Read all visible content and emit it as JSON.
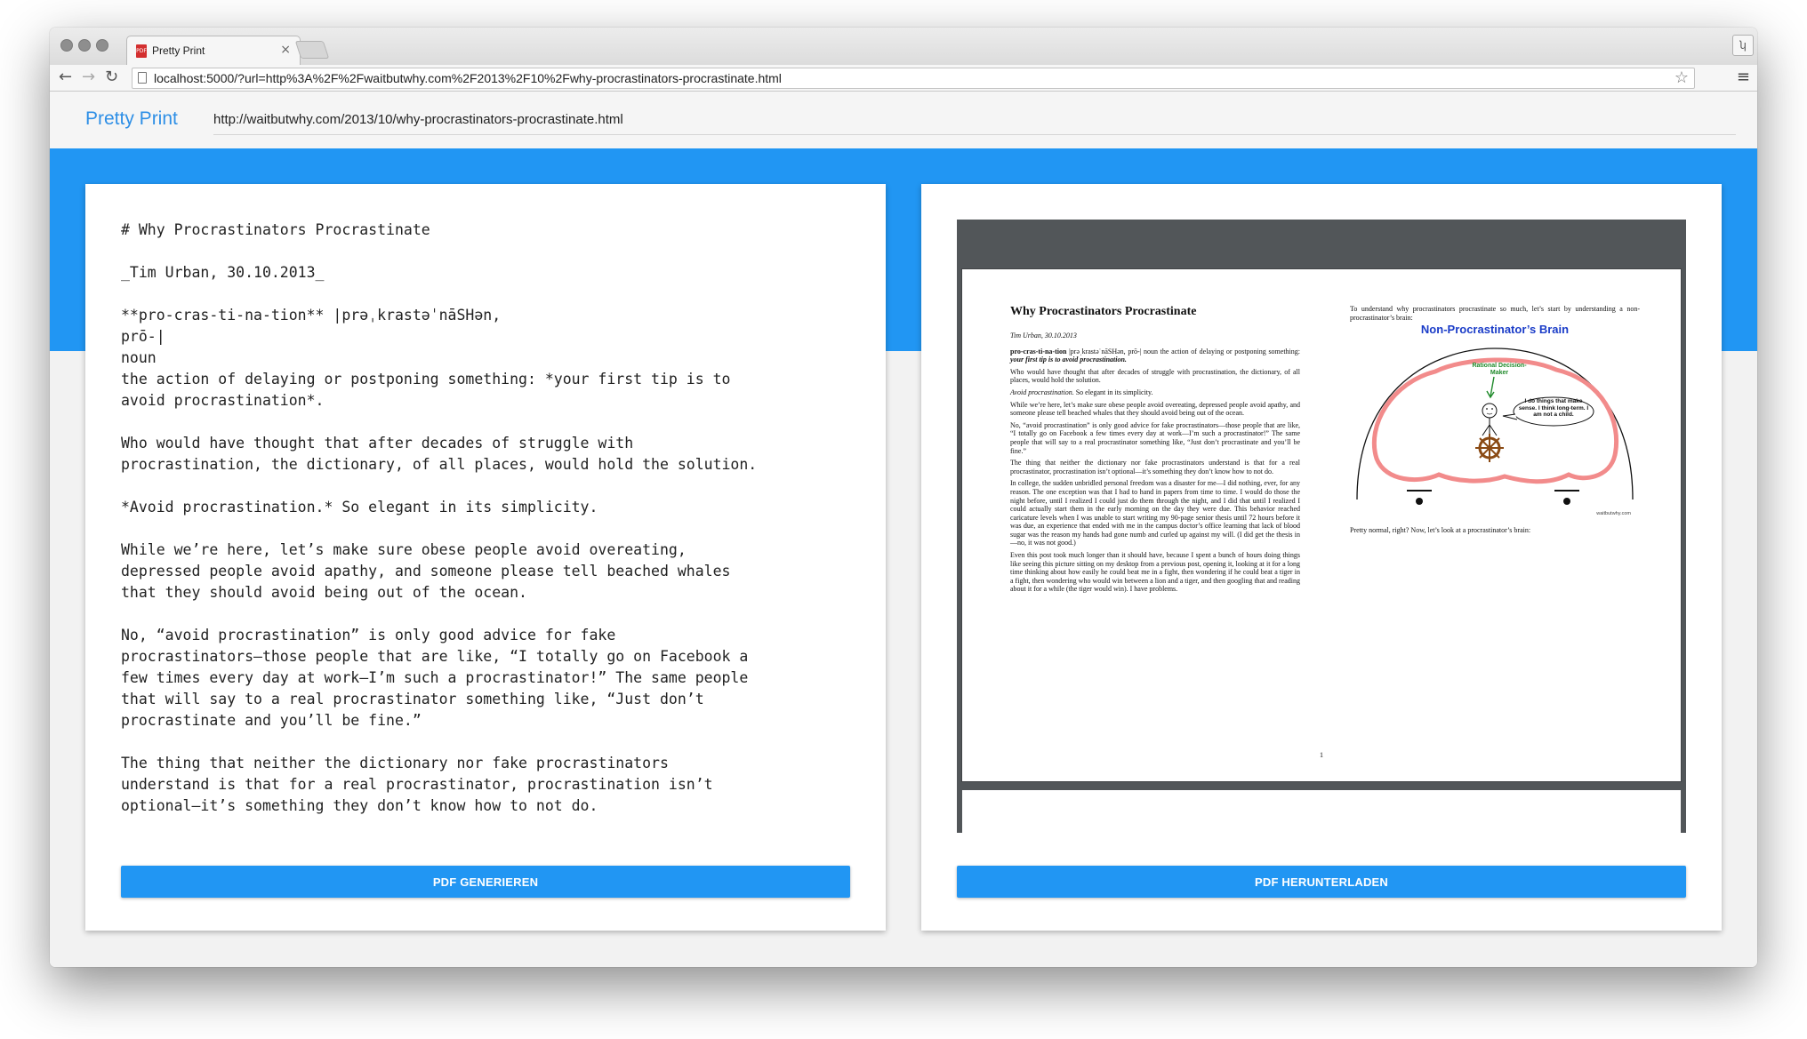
{
  "browser": {
    "tab_title": "Pretty Print",
    "tab_close": "×",
    "url": "localhost:5000/?url=http%3A%2F%2Fwaitbutwhy.com%2F2013%2F10%2Fwhy-procrastinators-procrastinate.html",
    "back_icon": "←",
    "forward_icon": "→",
    "reload_icon": "↻",
    "star_icon": "☆",
    "menu_icon": "≡"
  },
  "app": {
    "brand": "Pretty Print",
    "source_url": "http://waitbutwhy.com/2013/10/why-procrastinators-procrastinate.html",
    "accent_color": "#2196f3"
  },
  "editor": {
    "markdown": "# Why Procrastinators Procrastinate\n\n_Tim Urban, 30.10.2013_\n\n**pro-cras-ti-na-tion** |prəˌkrastəˈnāSHən,\nprō-|\nnoun\nthe action of delaying or postponing something: *your first tip is to\navoid procrastination*.\n\nWho would have thought that after decades of struggle with\nprocrastination, the dictionary, of all places, would hold the solution.\n\n*Avoid procrastination.* So elegant in its simplicity.\n\nWhile we’re here, let’s make sure obese people avoid overeating,\ndepressed people avoid apathy, and someone please tell beached whales\nthat they should avoid being out of the ocean.\n\nNo, “avoid procrastination” is only good advice for fake\nprocrastinators—those people that are like, “I totally go on Facebook a\nfew times every day at work—I’m such a procrastinator!” The same people\nthat will say to a real procrastinator something like, “Just don’t\nprocrastinate and you’ll be fine.”\n\nThe thing that neither the dictionary nor fake procrastinators\nunderstand is that for a real procrastinator, procrastination isn’t\noptional—it’s something they don’t know how to not do.",
    "generate_button": "PDF GENERIEREN"
  },
  "pdf": {
    "download_button": "PDF HERUNTERLADEN",
    "page_number": "1",
    "title": "Why Procrastinators Procrastinate",
    "byline": "Tim Urban, 30.10.2013",
    "def_term": "pro-cras-ti-na-tion",
    "def_rest": " |prəˌkrastəˈnāSHən, prō-| noun the action of delaying or postponing something: ",
    "def_italic": "your first tip is to avoid procrastination.",
    "p_who": "Who would have thought that after decades of struggle with procrastination, the dictionary, of all places, would hold the solution.",
    "avoid_italic": "Avoid procrastination.",
    "avoid_rest": " So elegant in its simplicity.",
    "p_while": "While we’re here, let’s make sure obese people avoid overeating, depressed people avoid apathy, and someone please tell beached whales that they should avoid being out of the ocean.",
    "p_no": "No, “avoid procrastination” is only good advice for fake procrastinators—those people that are like, “I totally go on Facebook a few times every day at work—I’m such a procrastinator!” The same people that will say to a real procrastinator something like, “Just don’t procrastinate and you’ll be fine.”",
    "p_thing": "The thing that neither the dictionary nor fake procrastinators understand is that for a real procrastinator, procrastination isn’t optional—it’s something they don’t know how to not do.",
    "p_college": "In college, the sudden unbridled personal freedom was a disaster for me—I did nothing, ever, for any reason. The one exception was that I had to hand in papers from time to time. I would do those the night before, until I realized I could just do them through the night, and I did that until I realized I could actually start them in the early morning on the day they were due. This behavior reached caricature levels when I was unable to start writing my 90-page senior thesis until 72 hours before it was due, an experience that ended with me in the campus doctor’s office learning that lack of blood sugar was the reason my hands had gone numb and curled up against my will. (I did get the thesis in—no, it was not good.)",
    "p_even": "Even this post took much longer than it should have, because I spent a bunch of hours doing things like seeing this picture sitting on my desktop from a previous post, opening it, looking at it for a long time thinking about how easily he could beat me in a fight, then wondering if he could beat a tiger in a fight, then wondering who would win between a lion and a tiger, and then googling that and reading about it for a while (the tiger would win). I have problems.",
    "p_understand": "To understand why procrastinators procrastinate so much, let’s start by understanding a non-procrastinator’s brain:",
    "figure_title": "Non-Procrastinator’s Brain",
    "figure_label": "Rational Decision-Maker",
    "figure_speech": "I do things that make sense. I think long-term. I am not a child.",
    "figure_watermark": "waitbutwhy.com",
    "p_normal": "Pretty normal, right? Now, let’s look at a procrastinator’s brain:"
  }
}
